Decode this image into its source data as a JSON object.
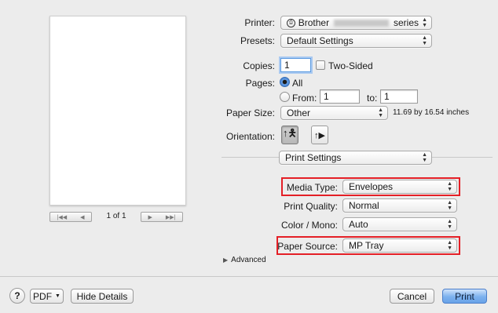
{
  "preview": {
    "page_indicator": "1 of 1",
    "nav_first_label": "|◀◀",
    "nav_prev_label": "◀",
    "nav_next_label": "▶",
    "nav_last_label": "▶▶|"
  },
  "printer": {
    "label": "Printer:",
    "brand": "Brother",
    "suffix": "series"
  },
  "presets": {
    "label": "Presets:",
    "value": "Default Settings"
  },
  "copies": {
    "label": "Copies:",
    "value": "1",
    "two_sided_label": "Two-Sided",
    "two_sided_checked": false
  },
  "pages": {
    "label": "Pages:",
    "all_label": "All",
    "from_label": "From:",
    "from_value": "1",
    "to_label": "to:",
    "to_value": "1"
  },
  "paper_size": {
    "label": "Paper Size:",
    "value": "Other",
    "dimensions": "11.69 by 16.54 inches"
  },
  "orientation": {
    "label": "Orientation:",
    "options": [
      "portrait-icon",
      "landscape-icon"
    ],
    "selected": "portrait"
  },
  "section": {
    "value": "Print Settings"
  },
  "settings": {
    "media_type_label": "Media Type:",
    "media_type_value": "Envelopes",
    "print_quality_label": "Print Quality:",
    "print_quality_value": "Normal",
    "color_mono_label": "Color / Mono:",
    "color_mono_value": "Auto",
    "paper_source_label": "Paper Source:",
    "paper_source_value": "MP Tray",
    "advanced_label": "Advanced"
  },
  "footer": {
    "help_label": "?",
    "pdf_label": "PDF",
    "hide_details_label": "Hide Details",
    "cancel_label": "Cancel",
    "print_label": "Print"
  },
  "colors": {
    "highlight": "#e41f26",
    "default_button": "#69a3e8",
    "focus_ring": "#a9c9f1"
  }
}
